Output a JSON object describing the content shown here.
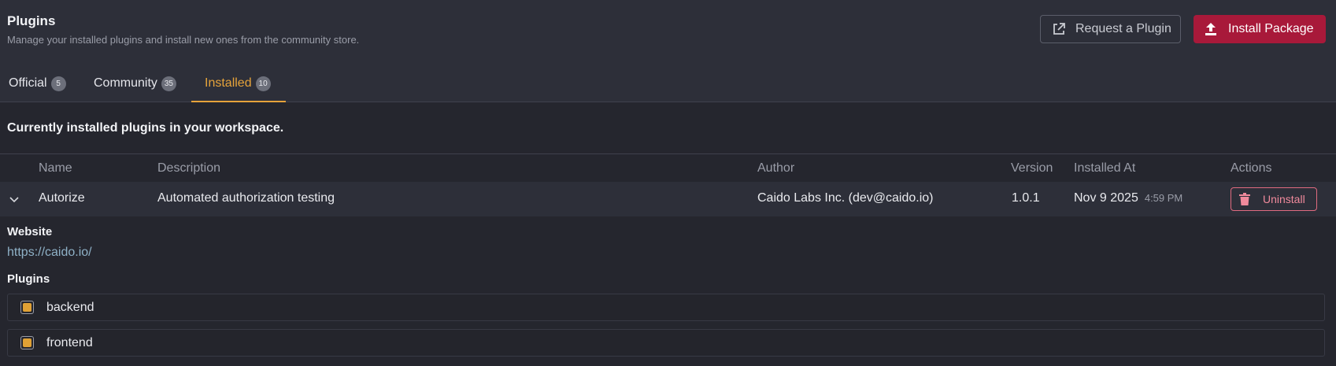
{
  "header": {
    "title": "Plugins",
    "subtitle": "Manage your installed plugins and install new ones from the community store.",
    "request_label": "Request a Plugin",
    "install_label": "Install Package"
  },
  "tabs": [
    {
      "label": "Official",
      "count": "5"
    },
    {
      "label": "Community",
      "count": "35"
    },
    {
      "label": "Installed",
      "count": "10",
      "active": true
    }
  ],
  "section_caption": "Currently installed plugins in your workspace.",
  "table": {
    "columns": [
      "Name",
      "Description",
      "Author",
      "Version",
      "Installed At",
      "Actions"
    ],
    "rows": [
      {
        "name": "Autorize",
        "description": "Automated authorization testing",
        "author": "Caido Labs Inc. (dev@caido.io)",
        "version": "1.0.1",
        "installed_date": "Nov 9 2025",
        "installed_time": "4:59 PM",
        "action_label": "Uninstall",
        "expanded": true
      }
    ]
  },
  "details": {
    "website_label": "Website",
    "website_url": "https://caido.io/",
    "plugins_label": "Plugins",
    "plugins": [
      {
        "name": "backend",
        "checked": true
      },
      {
        "name": "frontend",
        "checked": true
      }
    ]
  },
  "colors": {
    "accent": "#e6a33a",
    "install_button": "#a8193a",
    "danger": "#e06b80",
    "link": "#8fb1c7"
  },
  "icons": {
    "request": "external-link-icon",
    "install": "upload-icon",
    "expand": "chevron-down-icon",
    "uninstall": "trash-icon"
  }
}
